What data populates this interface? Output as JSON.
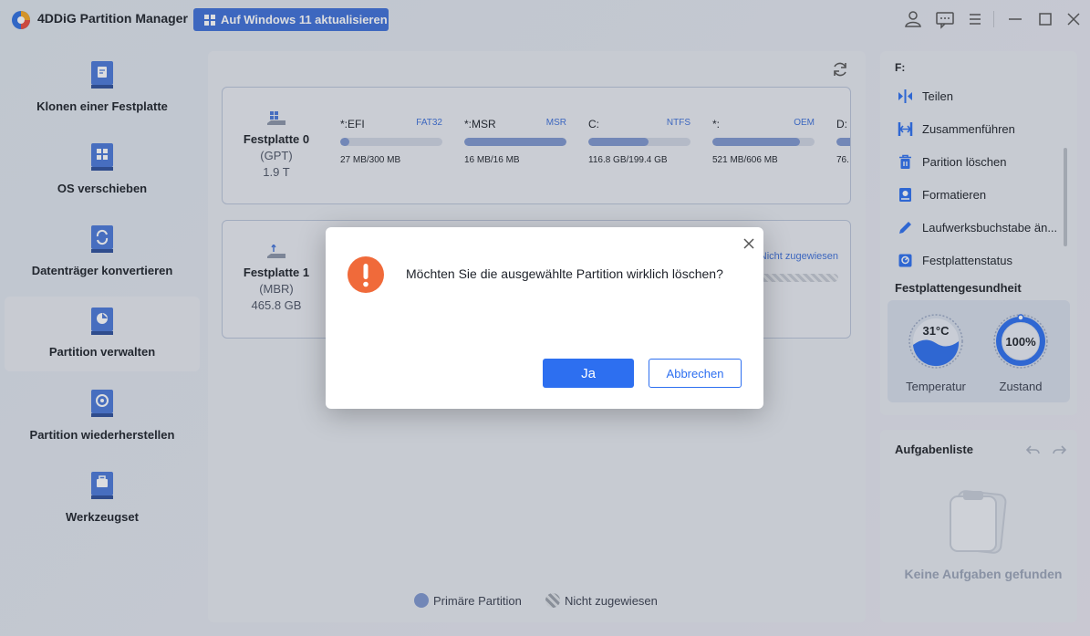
{
  "app": {
    "title": "4DDiG Partition Manager",
    "upgrade_label": "Auf Windows 11 aktualisieren",
    "accent": "#3d6fd8"
  },
  "titlebar_icons": [
    "user-icon",
    "feedback-icon",
    "menu-icon",
    "minimize-icon",
    "maximize-icon",
    "close-icon"
  ],
  "sidebar": {
    "items": [
      {
        "label": "Klonen einer Festplatte",
        "icon": "clone-disk-icon",
        "active": false
      },
      {
        "label": "OS verschieben",
        "icon": "migrate-os-icon",
        "active": false
      },
      {
        "label": "Datenträger konvertieren",
        "icon": "convert-disk-icon",
        "active": false
      },
      {
        "label": "Partition verwalten",
        "icon": "manage-partition-icon",
        "active": true
      },
      {
        "label": "Partition wiederherstellen",
        "icon": "recover-partition-icon",
        "active": false
      },
      {
        "label": "Werkzeugset",
        "icon": "toolkit-icon",
        "active": false
      }
    ]
  },
  "disks": [
    {
      "name": "Festplatte 0",
      "type": "(GPT)",
      "size": "1.9 T",
      "partitions": [
        {
          "label": "*:EFI",
          "fs": "FAT32",
          "size": "27 MB/300 MB",
          "used": 0.09
        },
        {
          "label": "*:MSR",
          "fs": "MSR",
          "size": "16 MB/16 MB",
          "used": 1.0
        },
        {
          "label": "C:",
          "fs": "NTFS",
          "size": "116.8 GB/199.4 GB",
          "used": 0.59
        },
        {
          "label": "*:",
          "fs": "OEM",
          "size": "521 MB/606 MB",
          "used": 0.86
        },
        {
          "label": "D:",
          "fs": "",
          "size": "76.",
          "used": 0.2
        }
      ]
    },
    {
      "name": "Festplatte 1",
      "type": "(MBR)",
      "size": "465.8 GB",
      "unallocated_label": "Nicht zugewiesen"
    }
  ],
  "right_panel": {
    "drive_letter": "F:",
    "actions": [
      {
        "label": "Teilen",
        "icon": "split-icon"
      },
      {
        "label": "Zusammenführen",
        "icon": "merge-icon"
      },
      {
        "label": "Parition löschen",
        "icon": "delete-icon"
      },
      {
        "label": "Formatieren",
        "icon": "format-icon"
      },
      {
        "label": "Laufwerksbuchstabe än...",
        "icon": "edit-letter-icon"
      },
      {
        "label": "Festplattenstatus",
        "icon": "disk-status-icon"
      }
    ],
    "health_title": "Festplattengesundheit",
    "temperature": {
      "value": "31°C",
      "label": "Temperatur"
    },
    "condition": {
      "value": "100%",
      "label": "Zustand",
      "fraction": 1.0
    }
  },
  "tasks": {
    "title": "Aufgabenliste",
    "empty_text": "Keine Aufgaben gefunden"
  },
  "legend": {
    "primary": "Primäre Partition",
    "unallocated": "Nicht zugewiesen"
  },
  "dialog": {
    "message": "Möchten Sie die ausgewählte Partition wirklich löschen?",
    "yes_label": "Ja",
    "cancel_label": "Abbrechen"
  }
}
